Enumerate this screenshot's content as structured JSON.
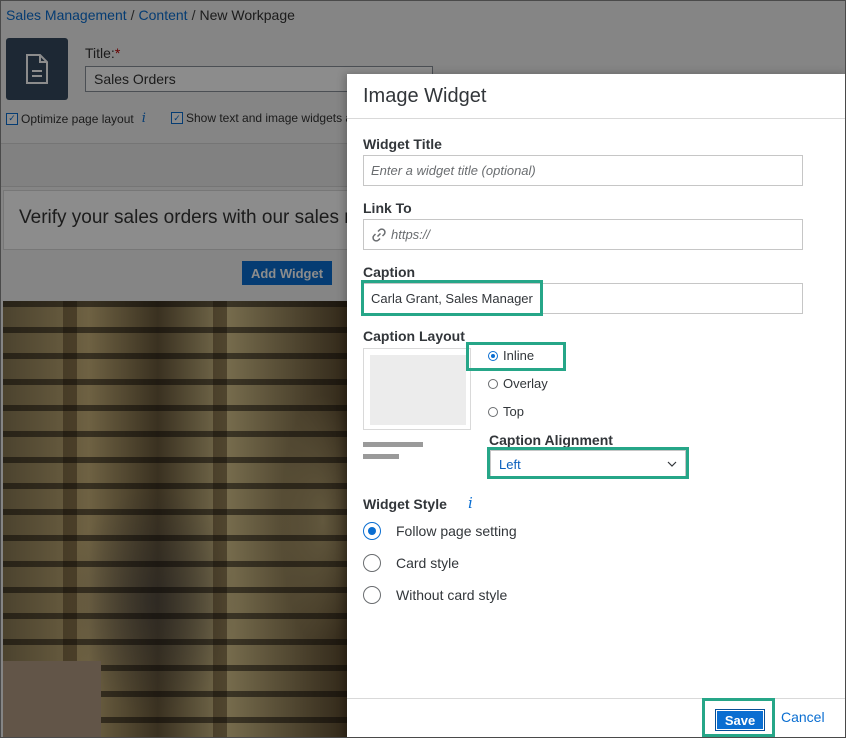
{
  "breadcrumb": {
    "items": [
      "Sales Management",
      "Content"
    ],
    "separator": "/",
    "current": "New Workpage"
  },
  "page": {
    "title_label": "Title:",
    "required_mark": "*",
    "title_value": "Sales Orders",
    "optimize_layout_label": "Optimize page layout",
    "show_widgets_label": "Show text and image widgets a",
    "info_glyph": "i",
    "verify_text": "Verify your sales orders with our sales m",
    "add_widget_label": "Add Widget"
  },
  "dialog": {
    "title": "Image Widget",
    "widget_title": {
      "label": "Widget Title",
      "placeholder": "Enter a widget title (optional)"
    },
    "link_to": {
      "label": "Link To",
      "placeholder": "https://"
    },
    "caption": {
      "label": "Caption",
      "value": "Carla Grant, Sales Manager"
    },
    "caption_layout": {
      "label": "Caption Layout",
      "options": [
        {
          "label": "Inline",
          "selected": true
        },
        {
          "label": "Overlay",
          "selected": false
        },
        {
          "label": "Top",
          "selected": false
        }
      ]
    },
    "caption_alignment": {
      "label": "Caption Alignment",
      "value": "Left"
    },
    "widget_style": {
      "label": "Widget Style",
      "info_glyph": "i",
      "options": [
        {
          "label": "Follow page setting",
          "selected": true
        },
        {
          "label": "Card style",
          "selected": false
        },
        {
          "label": "Without card style",
          "selected": false
        }
      ]
    },
    "footer": {
      "save_label": "Save",
      "cancel_label": "Cancel"
    }
  },
  "colors": {
    "accent": "#0a6ed1",
    "highlight": "#26a688",
    "shell_icon_bg": "#354a5f"
  },
  "icons": [
    "document-icon",
    "info-icon",
    "link-icon",
    "chevron-down-icon",
    "checkmark-icon"
  ]
}
